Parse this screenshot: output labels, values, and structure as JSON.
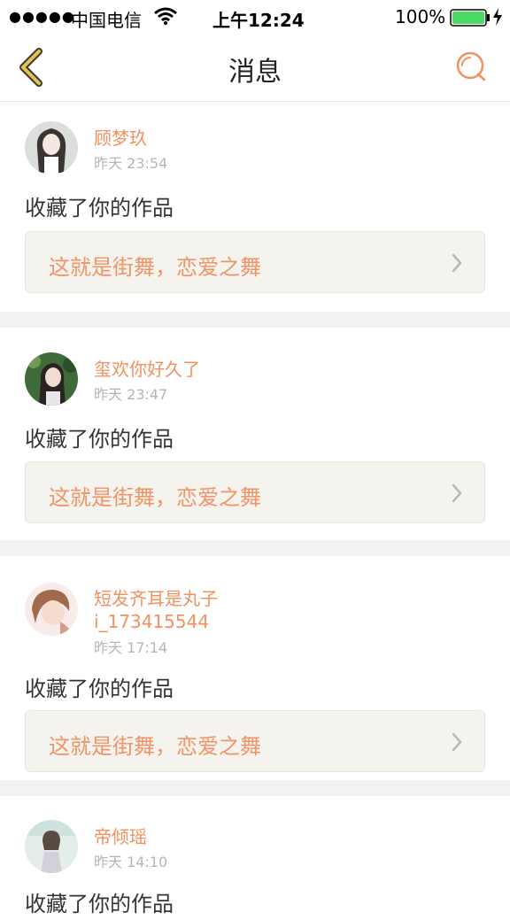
{
  "status_bar": {
    "signal": "●●●●●",
    "carrier": "中国电信",
    "time": "上午12:24",
    "battery": "100%"
  },
  "nav": {
    "title": "消息",
    "back_icon": "chevron-left-icon",
    "search_icon": "search-icon"
  },
  "colors": {
    "accent": "#f0915f",
    "link_bg": "#f4f3ee",
    "back_icon": "#e6c34a"
  },
  "messages": [
    {
      "username": "顾梦玖",
      "time": "昨天 23:54",
      "action": "收藏了你的作品",
      "work_title": "这就是街舞，恋爱之舞"
    },
    {
      "username": "玺欢你好久了",
      "time": "昨天 23:47",
      "action": "收藏了你的作品",
      "work_title": "这就是街舞，恋爱之舞"
    },
    {
      "username": "短发齐耳是丸子",
      "username_line2": "i_173415544",
      "time": "昨天 17:14",
      "action": "收藏了你的作品",
      "work_title": "这就是街舞，恋爱之舞"
    },
    {
      "username": "帝倾瑶",
      "time": "昨天 14:10",
      "action": "收藏了你的作品"
    }
  ]
}
